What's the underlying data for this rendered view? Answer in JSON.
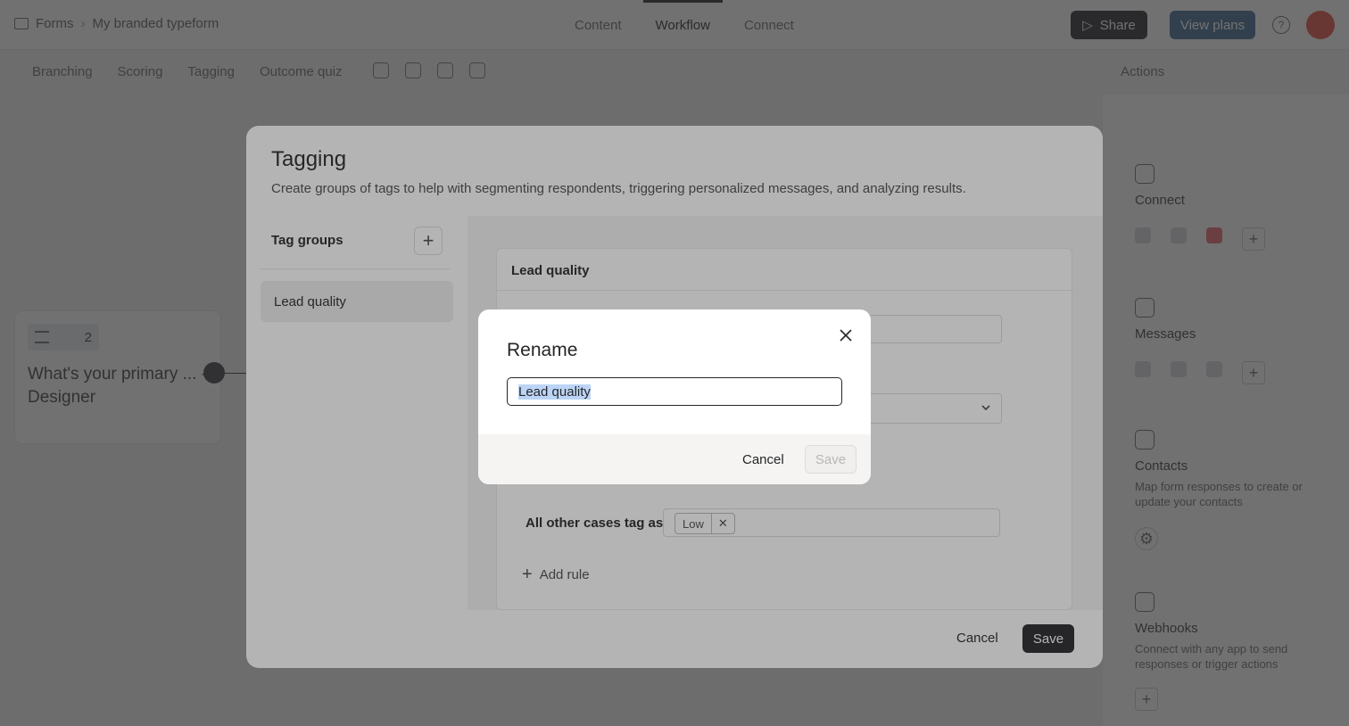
{
  "header": {
    "breadcrumb": {
      "root": "Forms",
      "current": "My branded typeform"
    },
    "tabs": [
      "Content",
      "Workflow",
      "Connect"
    ],
    "active_tab": "Workflow",
    "share_label": "Share",
    "plans_label": "View plans"
  },
  "subnav": {
    "tabs": [
      "Branching",
      "Scoring",
      "Tagging",
      "Outcome quiz"
    ],
    "actions_label": "Actions"
  },
  "canvas": {
    "question_number": "2",
    "question_title": "What's your primary ... - Designer"
  },
  "right_panel": {
    "connect_title": "Connect",
    "messages_title": "Messages",
    "contacts_title": "Contacts",
    "contacts_desc": "Map form responses to create or update your contacts",
    "webhooks_title": "Webhooks",
    "webhooks_desc": "Connect with any app to send responses or trigger actions"
  },
  "tagging": {
    "title": "Tagging",
    "description": "Create groups of tags to help with segmenting respondents, triggering personalized messages, and analyzing results.",
    "groups_label": "Tag groups",
    "groups": [
      "Lead quality"
    ],
    "editor": {
      "group_name": "Lead quality",
      "other_cases_label": "All other cases tag as",
      "other_cases_tag": "Low",
      "add_rule_label": "Add rule"
    },
    "cancel_label": "Cancel",
    "save_label": "Save"
  },
  "rename_dialog": {
    "title": "Rename",
    "input_value": "Lead quality",
    "cancel_label": "Cancel",
    "save_label": "Save"
  }
}
